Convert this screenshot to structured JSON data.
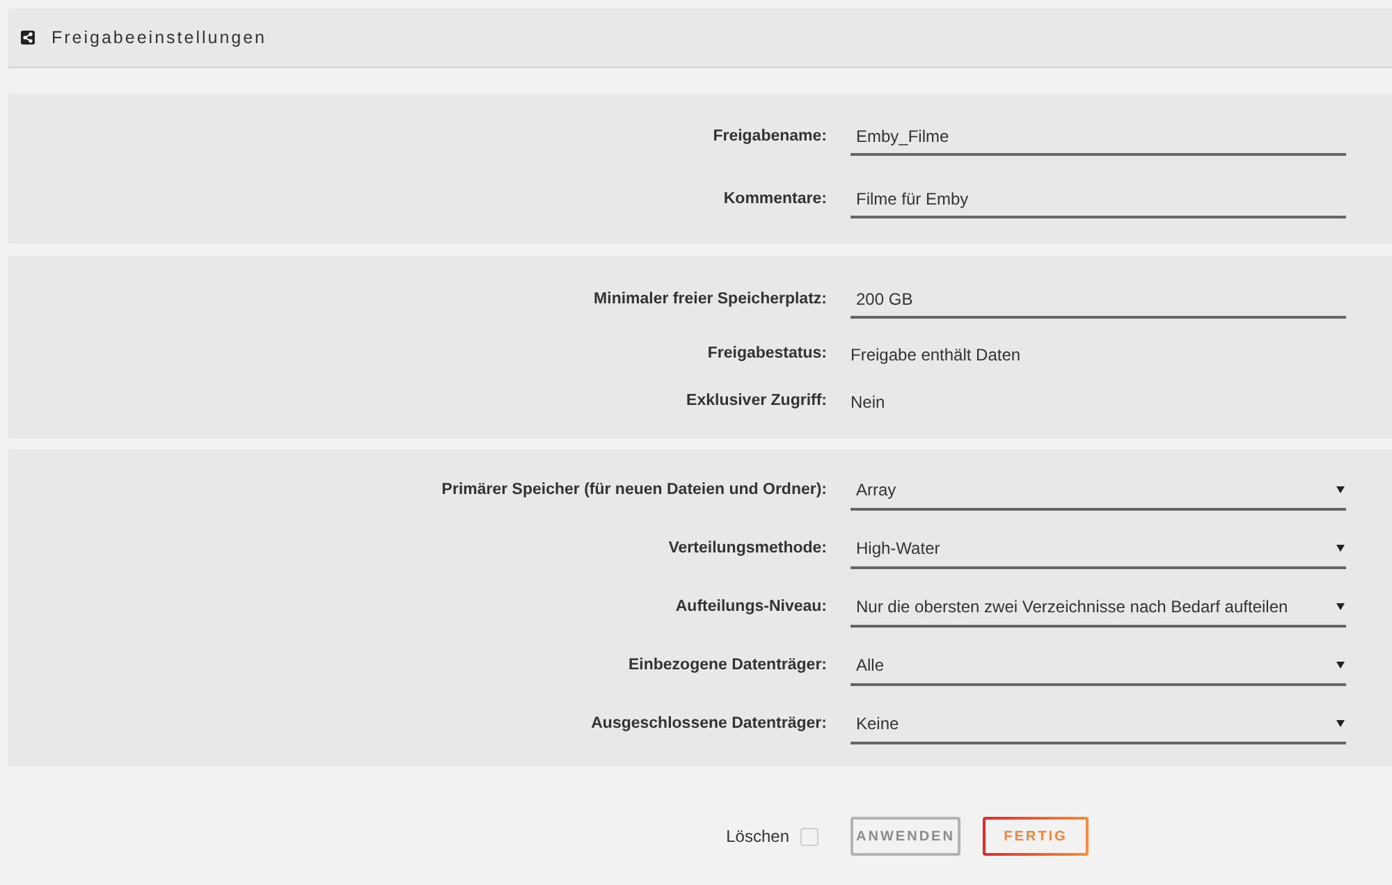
{
  "header": {
    "title": "Freigabeeinstellungen"
  },
  "sections": [
    {
      "rows": [
        {
          "kind": "input",
          "label": "Freigabename:",
          "value": "Emby_Filme"
        },
        {
          "kind": "input",
          "label": "Kommentare:",
          "value": "Filme für Emby"
        }
      ]
    },
    {
      "rows": [
        {
          "kind": "input",
          "label": "Minimaler freier Speicherplatz:",
          "value": "200 GB"
        },
        {
          "kind": "text",
          "label": "Freigabestatus:",
          "value": "Freigabe enthält Daten"
        },
        {
          "kind": "text",
          "label": "Exklusiver Zugriff:",
          "value": "Nein"
        }
      ]
    },
    {
      "rows": [
        {
          "kind": "select",
          "label": "Primärer Speicher (für neuen Dateien und Ordner):",
          "value": "Array"
        },
        {
          "kind": "select",
          "label": "Verteilungsmethode:",
          "value": "High-Water"
        },
        {
          "kind": "select",
          "label": "Aufteilungs-Niveau:",
          "value": "Nur die obersten zwei Verzeichnisse nach Bedarf aufteilen"
        },
        {
          "kind": "select",
          "label": "Einbezogene Datenträger:",
          "value": "Alle"
        },
        {
          "kind": "select",
          "label": "Ausgeschlossene Datenträger:",
          "value": "Keine"
        }
      ]
    }
  ],
  "footer": {
    "delete": {
      "label": "Löschen",
      "checked": false
    },
    "buttons": [
      {
        "label": "ANWENDEN",
        "disabled": true
      },
      {
        "label": "FERTIG",
        "disabled": false
      }
    ]
  }
}
